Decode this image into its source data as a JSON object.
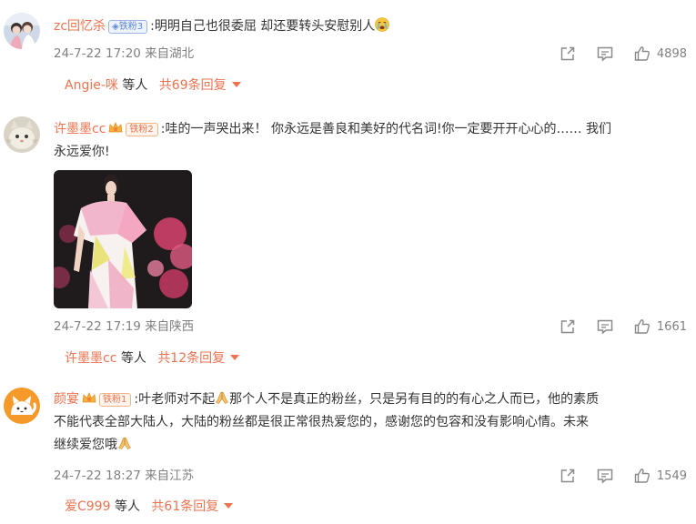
{
  "comments": [
    {
      "username": "zc回忆杀",
      "badge": "铁粉3",
      "text_lines": [
        ":明明自己也很委屈   却还要转头安慰别人"
      ],
      "emoji": "crying-face",
      "meta": "24-7-22 17:20 来自湖北",
      "likes": "4898",
      "reply_user": "Angie-咪",
      "reply_mid": " 等人 ",
      "reply_count": "共69条回复"
    },
    {
      "username": "许墨墨cc",
      "badge": "铁粉2",
      "text_lines": [
        ":哇的一声哭出来！ 你永远是善良和美好的代名词!你一定要开开心心的…… 我们",
        "永远爱你!"
      ],
      "meta": "24-7-22 17:19 来自陕西",
      "likes": "1661",
      "reply_user": "许墨墨cc",
      "reply_mid": " 等人 ",
      "reply_count": "共12条回复"
    },
    {
      "username": "颜宴",
      "badge": "铁粉1",
      "text_lines": [
        ":叶老师对不起",
        "那个人不是真正的粉丝，只是另有目的的有心之人而已，他的素质",
        "不能代表全部大陆人，大陆的粉丝都是很正常很热爱您的，感谢您的包容和没有影响心情。未来",
        "继续爱您哦"
      ],
      "meta": "24-7-22 18:27 来自江苏",
      "likes": "1549",
      "reply_user": "爱C999",
      "reply_mid": " 等人 ",
      "reply_count": "共61条回复"
    }
  ],
  "icons": {
    "share": "share-icon",
    "comment": "comment-icon",
    "like": "thumbs-up-icon",
    "pray": "praying-hands-emoji",
    "crown": "fan-crown-icon"
  },
  "colors": {
    "username": "#eb7350",
    "meta": "#808080",
    "text": "#333333"
  }
}
